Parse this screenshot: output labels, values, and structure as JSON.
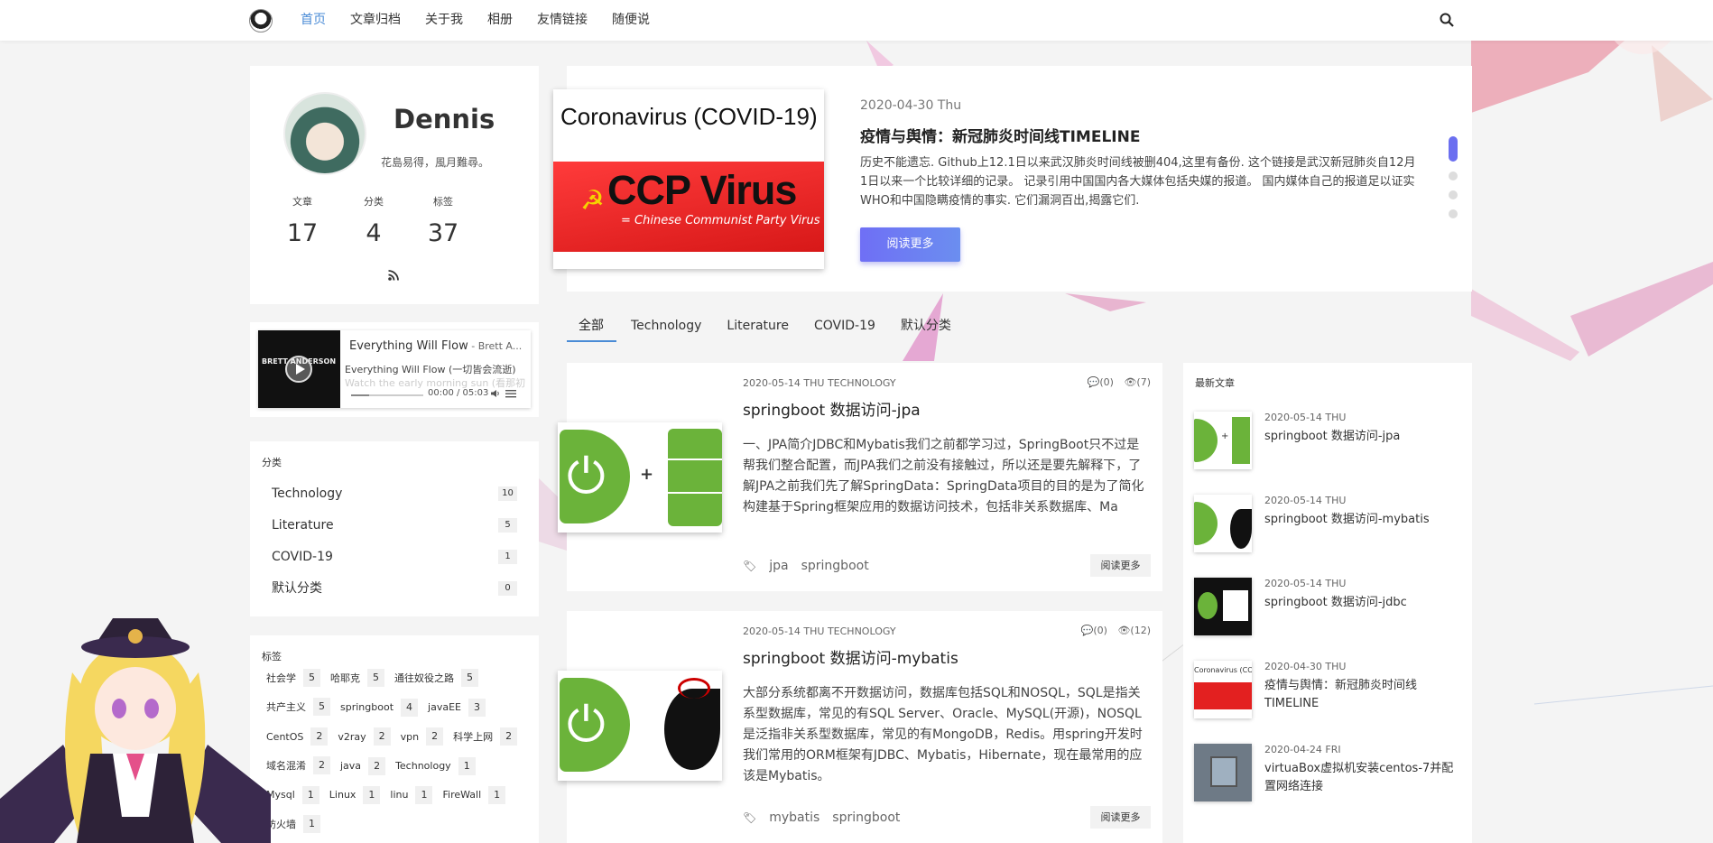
{
  "header": {
    "nav": [
      "首页",
      "文章归档",
      "关于我",
      "相册",
      "友情链接",
      "随便说"
    ],
    "active_index": 0
  },
  "profile": {
    "name": "Dennis",
    "motto": "花島易得，風月難尋。",
    "stats": [
      {
        "label": "文章",
        "value": "17"
      },
      {
        "label": "分类",
        "value": "4"
      },
      {
        "label": "标签",
        "value": "37"
      }
    ]
  },
  "music": {
    "title": "Everything Will Flow",
    "artist": " - Brett A...",
    "lyric_current": "Everything Will Flow (一切皆会流逝)",
    "lyric_next": "Watch the early morning sun (看那初",
    "time": "00:00 / 05:03",
    "cover_text": "BRETT ANDERSON",
    "progress": 0.0
  },
  "categories": {
    "title": "分类",
    "items": [
      {
        "name": "Technology",
        "count": "10"
      },
      {
        "name": "Literature",
        "count": "5"
      },
      {
        "name": "COVID-19",
        "count": "1"
      },
      {
        "name": "默认分类",
        "count": "0"
      }
    ]
  },
  "tags": {
    "title": "标签",
    "items": [
      {
        "name": "社会学",
        "count": "5"
      },
      {
        "name": "哈耶克",
        "count": "5"
      },
      {
        "name": "通往奴役之路",
        "count": "5"
      },
      {
        "name": "共产主义",
        "count": "5"
      },
      {
        "name": "springboot",
        "count": "4"
      },
      {
        "name": "javaEE",
        "count": "3"
      },
      {
        "name": "CentOS",
        "count": "2"
      },
      {
        "name": "v2ray",
        "count": "2"
      },
      {
        "name": "vpn",
        "count": "2"
      },
      {
        "name": "科学上网",
        "count": "2"
      },
      {
        "name": "域名混淆",
        "count": "2"
      },
      {
        "name": "java",
        "count": "2"
      },
      {
        "name": "Technology",
        "count": "1"
      },
      {
        "name": "Mysql",
        "count": "1"
      },
      {
        "name": "Linux",
        "count": "1"
      },
      {
        "name": "linu",
        "count": "1"
      },
      {
        "name": "FireWall",
        "count": "1"
      },
      {
        "name": "防火墙",
        "count": "1"
      }
    ]
  },
  "featured": {
    "image_title": "Coronavirus (COVID-19)",
    "image_big": "CCP Virus",
    "image_sub": "= Chinese Communist Party Virus",
    "date": "2020-04-30 Thu",
    "title": "疫情与舆情：新冠肺炎时间线TIMELINE",
    "body": "历史不能遗忘. Github上12.1日以来武汉肺炎时间线被删404,这里有备份. 这个链接是武汉新冠肺炎自12月1日以来一个比较详细的记录。 记录引用中国国内各大媒体包括央媒的报道。 国内媒体自己的报道足以证实WHO和中国隐瞒疫情的事实. 它们漏洞百出,揭露它们.",
    "button": "阅读更多"
  },
  "tabs": [
    "全部",
    "Technology",
    "Literature",
    "COVID-19",
    "默认分类"
  ],
  "posts": [
    {
      "meta": "2020-05-14 THU    TECHNOLOGY",
      "comments": "(0)",
      "views": "(7)",
      "title": "springboot 数据访问-jpa",
      "body": "一、JPA简介JDBC和Mybatis我们之前都学习过，SpringBoot只不过是帮我们整合配置，而JPA我们之前没有接触过，所以还是要先解释下，了解JPA之前我们先了解SpringData：SpringData项目的目的是为了简化构建基于Spring框架应用的数据访问技术，包括非关系数据库、Ma",
      "tags": [
        "jpa",
        "springboot"
      ],
      "more": "阅读更多"
    },
    {
      "meta": "2020-05-14 THU    TECHNOLOGY",
      "comments": "(0)",
      "views": "(12)",
      "title": "springboot 数据访问-mybatis",
      "body": "大部分系统都离不开数据访问，数据库包括SQL和NOSQL，SQL是指关系型数据库，常见的有SQL Server、Oracle、MySQL(开源)，NOSQL是泛指非关系型数据库，常见的有MongoDB，Redis。用spring开发时我们常用的ORM框架有JDBC、Mybatis，Hibernate，现在最常用的应该是Mybatis。",
      "tags": [
        "mybatis",
        "springboot"
      ],
      "more": "阅读更多"
    }
  ],
  "recent": {
    "title": "最新文章",
    "items": [
      {
        "date": "2020-05-14 THU",
        "title": "springboot 数据访问-jpa"
      },
      {
        "date": "2020-05-14 THU",
        "title": "springboot 数据访问-mybatis"
      },
      {
        "date": "2020-05-14 THU",
        "title": "springboot 数据访问-jdbc"
      },
      {
        "date": "2020-04-30 THU",
        "title": "疫情与舆情：新冠肺炎时间线TIMELINE"
      },
      {
        "date": "2020-04-24 FRI",
        "title": "virtuaBox虚拟机安装centos-7并配置网络连接"
      }
    ]
  },
  "colors": {
    "accent": "#4a8bd6",
    "button": "#6b6ff0",
    "spring_green": "#6bb33a"
  }
}
